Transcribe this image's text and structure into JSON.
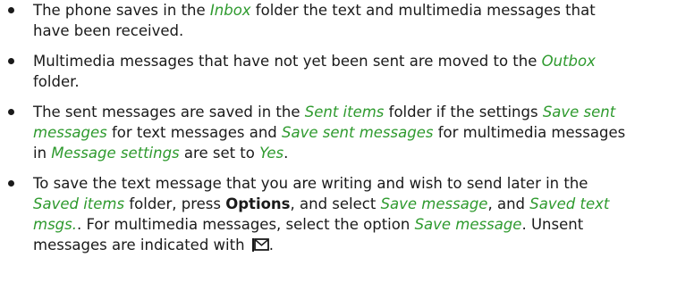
{
  "colors": {
    "text": "#1a1a1a",
    "highlight": "#2e9a2e"
  },
  "icons": {
    "unsent": "envelope-icon"
  },
  "bullets": [
    {
      "lines": [
        [
          "The phone saves in the ",
          "Inbox",
          " folder the text and multimedia messages that"
        ],
        [
          "have been received."
        ]
      ]
    },
    {
      "lines": [
        [
          "Multimedia messages that have not yet been sent are moved to the ",
          "Outbox"
        ],
        [
          "folder."
        ]
      ]
    },
    {
      "lines": [
        [
          "The sent messages are saved in the ",
          "Sent items",
          " folder if the settings ",
          "Save sent"
        ],
        [
          "messages",
          " for text messages and ",
          "Save sent messages",
          " for multimedia messages"
        ],
        [
          "in ",
          "Message settings",
          " are set to ",
          "Yes",
          "."
        ]
      ]
    },
    {
      "lines": [
        [
          "To save the text message that you are writing and wish to send later in the"
        ],
        [
          "Saved items",
          " folder, press ",
          "Options",
          ", and select ",
          "Save message",
          ", and ",
          "Saved text"
        ],
        [
          "msgs.",
          ". For multimedia messages, select the option ",
          "Save message",
          ". Unsent"
        ],
        [
          "messages are indicated with ",
          "."
        ]
      ]
    }
  ]
}
